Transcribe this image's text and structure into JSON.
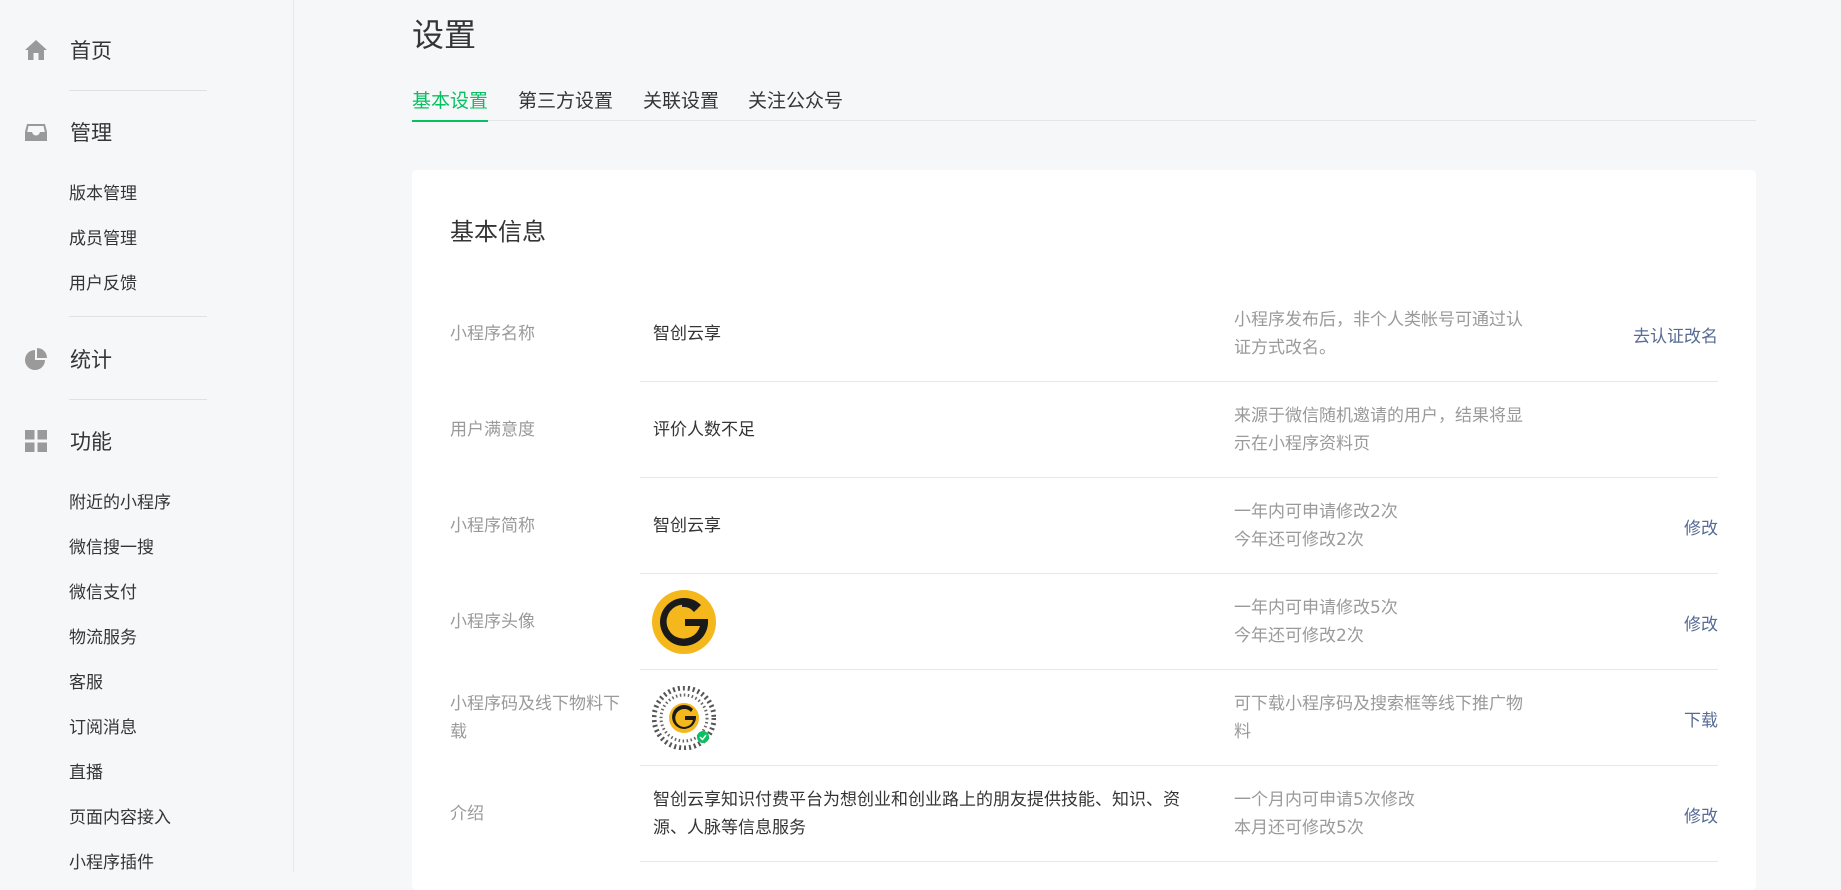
{
  "sidebar": {
    "home": {
      "label": "首页",
      "icon": "home-icon"
    },
    "manage": {
      "label": "管理",
      "icon": "inbox-icon",
      "items": [
        "版本管理",
        "成员管理",
        "用户反馈"
      ]
    },
    "stats": {
      "label": "统计",
      "icon": "pie-chart-icon"
    },
    "features": {
      "label": "功能",
      "icon": "grid-icon",
      "items": [
        "附近的小程序",
        "微信搜一搜",
        "微信支付",
        "物流服务",
        "客服",
        "订阅消息",
        "直播",
        "页面内容接入",
        "小程序插件"
      ]
    }
  },
  "page": {
    "title": "设置"
  },
  "tabs": [
    {
      "label": "基本设置",
      "active": true
    },
    {
      "label": "第三方设置",
      "active": false
    },
    {
      "label": "关联设置",
      "active": false
    },
    {
      "label": "关注公众号",
      "active": false
    }
  ],
  "card": {
    "title": "基本信息",
    "rows": [
      {
        "label": "小程序名称",
        "value": "智创云享",
        "tip1": "小程序发布后，非个人类帐号可通过认",
        "tip2": "证方式改名。",
        "action": "去认证改名"
      },
      {
        "label": "用户满意度",
        "value": "评价人数不足",
        "tip1": "来源于微信随机邀请的用户，结果将显",
        "tip2": "示在小程序资料页",
        "action": ""
      },
      {
        "label": "小程序简称",
        "value": "智创云享",
        "tip1": "一年内可申请修改2次",
        "tip2": "今年还可修改2次",
        "action": "修改"
      },
      {
        "label": "小程序头像",
        "value": "",
        "tip1": "一年内可申请修改5次",
        "tip2": "今年还可修改2次",
        "action": "修改"
      },
      {
        "label": "小程序码及线下物料下载",
        "value": "",
        "tip1": "可下载小程序码及搜索框等线下推广物",
        "tip2": "料",
        "action": "下载"
      },
      {
        "label": "介绍",
        "value": "智创云享知识付费平台为想创业和创业路上的朋友提供技能、知识、资源、人脉等信息服务",
        "tip1": "一个月内可申请5次修改",
        "tip2": "本月还可修改5次",
        "action": "修改"
      }
    ]
  },
  "colors": {
    "accent": "#07c160",
    "link": "#576b95",
    "avatar": "#f5b81c"
  }
}
